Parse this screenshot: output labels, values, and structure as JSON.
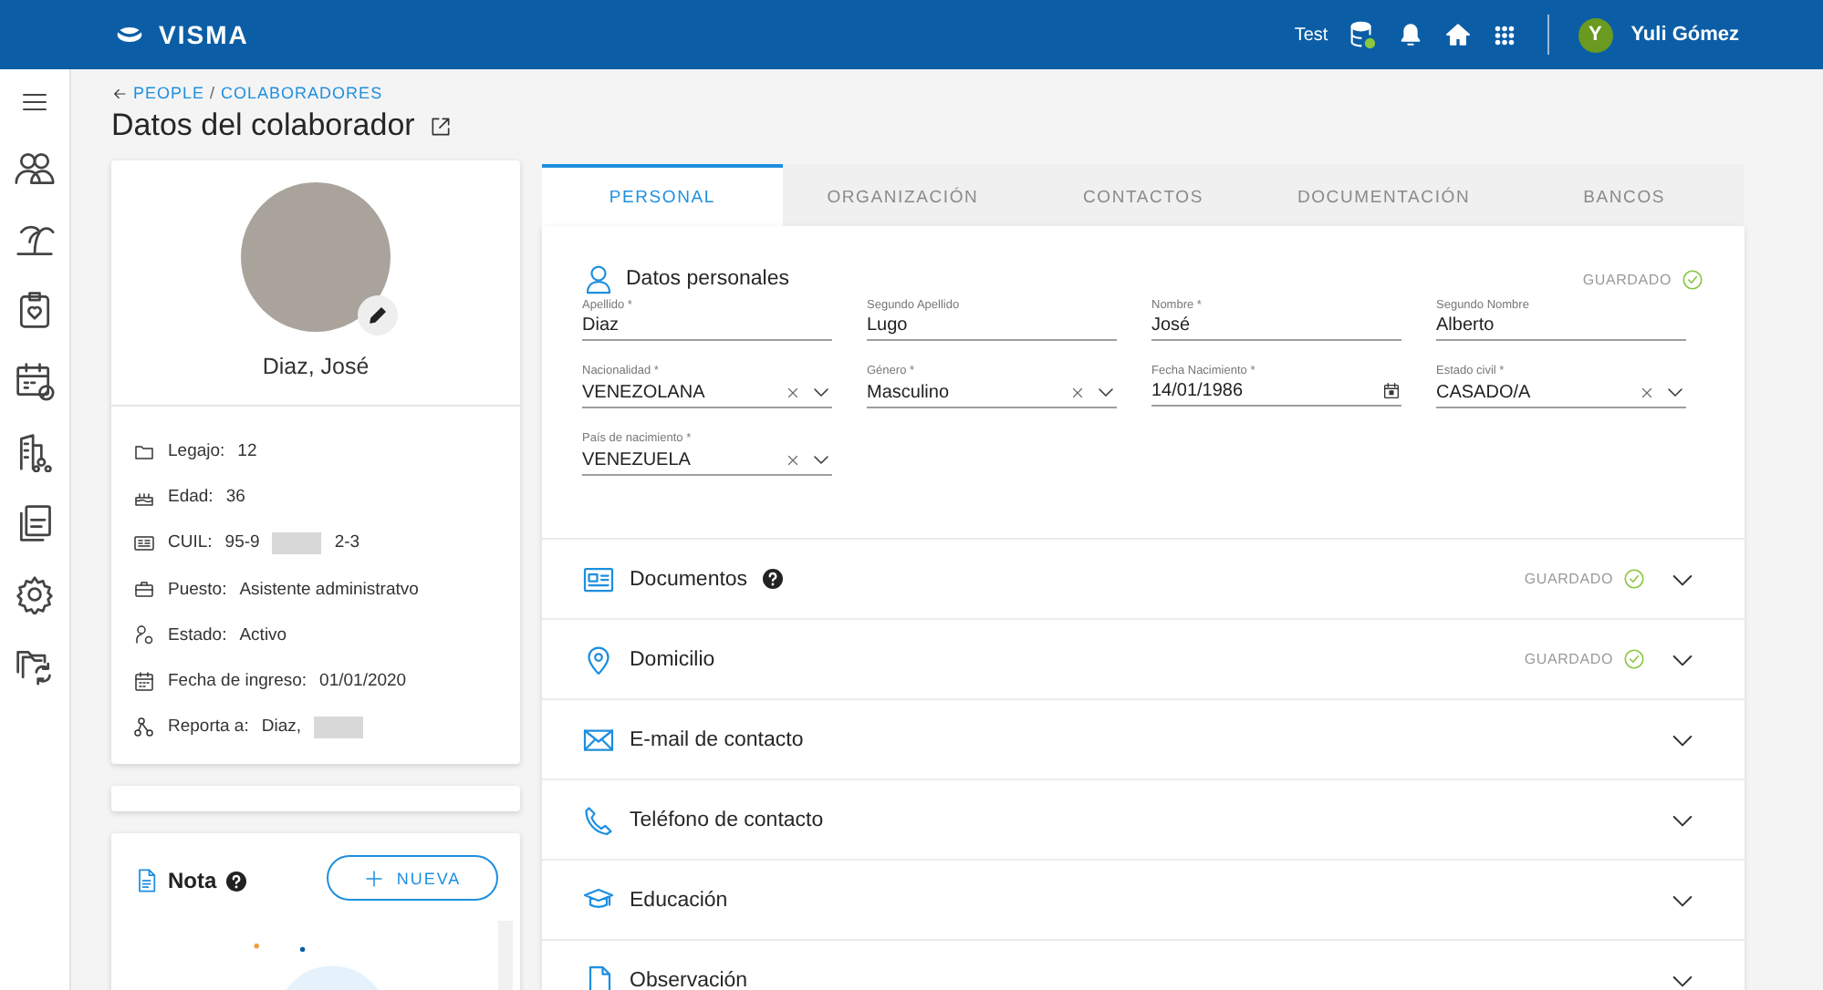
{
  "header": {
    "logo": "VISMA",
    "environment": "Test",
    "user": {
      "initial": "Y",
      "name": "Yuli Gómez"
    }
  },
  "breadcrumb": [
    {
      "label": "PEOPLE"
    },
    {
      "label": "COLABORADORES"
    }
  ],
  "breadcrumb_separator": "/",
  "page_title": "Datos del colaborador",
  "profile": {
    "name": "Diaz, José",
    "info": [
      {
        "label": "Legajo:",
        "value": "12",
        "redacted": false
      },
      {
        "label": "Edad:",
        "value": "36",
        "redacted": false
      },
      {
        "label": "CUIL:",
        "value": "95-9",
        "redacted": true,
        "value_end": "2-3"
      },
      {
        "label": "Puesto:",
        "value": "Asistente administratvo",
        "redacted": false
      },
      {
        "label": "Estado:",
        "value": "Activo",
        "redacted": false
      },
      {
        "label": "Fecha de ingreso:",
        "value": "01/01/2020",
        "redacted": false
      },
      {
        "label": "Reporta a:",
        "value": "Diaz,",
        "redacted": true
      }
    ]
  },
  "note": {
    "title": "Nota",
    "button": "NUEVA"
  },
  "tabs": [
    {
      "label": "PERSONAL",
      "selected": true
    },
    {
      "label": "ORGANIZACIÓN",
      "selected": false
    },
    {
      "label": "CONTACTOS",
      "selected": false
    },
    {
      "label": "DOCUMENTACIÓN",
      "selected": false
    },
    {
      "label": "BANCOS",
      "selected": false
    }
  ],
  "personal": {
    "title": "Datos personales",
    "status": "GUARDADO",
    "fields": [
      {
        "kind": "text",
        "label": "Apellido *",
        "value": "Diaz"
      },
      {
        "kind": "text",
        "label": "Segundo Apellido",
        "value": "Lugo"
      },
      {
        "kind": "text",
        "label": "Nombre *",
        "value": "José"
      },
      {
        "kind": "text",
        "label": "Segundo Nombre",
        "value": "Alberto"
      },
      {
        "kind": "select",
        "label": "Nacionalidad *",
        "value": "VENEZOLANA"
      },
      {
        "kind": "select",
        "label": "Género *",
        "value": "Masculino"
      },
      {
        "kind": "date",
        "label": "Fecha Nacimiento *",
        "value": "14/01/1986"
      },
      {
        "kind": "select",
        "label": "Estado civil *",
        "value": "CASADO/A"
      },
      {
        "kind": "select",
        "label": "País de nacimiento *",
        "value": "VENEZUELA"
      }
    ]
  },
  "sections": [
    {
      "title": "Documentos",
      "help": true,
      "status": "GUARDADO"
    },
    {
      "title": "Domicilio",
      "help": false,
      "status": "GUARDADO"
    },
    {
      "title": "E-mail de contacto",
      "help": false
    },
    {
      "title": "Teléfono de contacto",
      "help": false
    },
    {
      "title": "Educación",
      "help": false
    },
    {
      "title": "Observación",
      "help": false
    }
  ]
}
